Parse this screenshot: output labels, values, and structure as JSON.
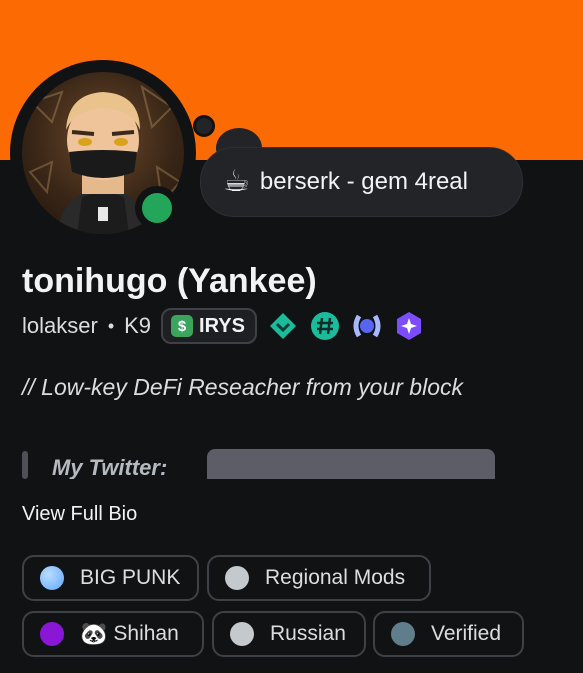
{
  "profile": {
    "display_name": "tonihugo (Yankee)",
    "username": "lolakser",
    "pronoun_tag": "K9",
    "separator": "•",
    "online_status": "online",
    "banner_color": "#fc6a03"
  },
  "custom_status": {
    "emoji": "☕",
    "text": "berserk - gem 4real"
  },
  "server_tag": {
    "icon_glyph": "$",
    "label": "IRYS"
  },
  "badges": [
    {
      "name": "nitro-gem-icon",
      "color": "#1abc9c"
    },
    {
      "name": "hashtag-icon",
      "color": "#1abc9c"
    },
    {
      "name": "laurel-icon",
      "color": "#a8b8ff"
    },
    {
      "name": "quest-icon",
      "color": "#9b59ff"
    }
  ],
  "bio": {
    "line1": "// Low-key DeFi Reseacher from your block",
    "twitter_label": "My Twitter:",
    "view_full": "View Full Bio"
  },
  "roles": [
    {
      "label": "BIG PUNK",
      "color": "#5fa8ff"
    },
    {
      "label": "Regional Mods",
      "color": "#c4c9ce"
    },
    {
      "label": "Shihan",
      "color": "#8a16d6",
      "emoji": "🐼"
    },
    {
      "label": "Russian",
      "color": "#c4c9ce"
    },
    {
      "label": "Verified",
      "color": "#607d8b"
    }
  ]
}
